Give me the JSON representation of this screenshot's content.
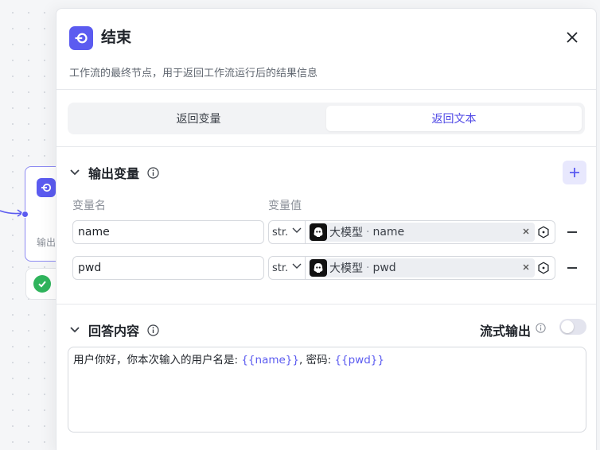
{
  "canvas": {
    "node_label": "输出"
  },
  "panel": {
    "title": "结束",
    "description": "工作流的最终节点，用于返回工作流运行后的结果信息",
    "tabs": [
      {
        "label": "返回变量",
        "active": false
      },
      {
        "label": "返回文本",
        "active": true
      }
    ]
  },
  "output_vars": {
    "title": "输出变量",
    "col_name": "变量名",
    "col_value": "变量值",
    "rows": [
      {
        "name": "name",
        "type": "str.",
        "source": "大模型",
        "field": "name"
      },
      {
        "name": "pwd",
        "type": "str.",
        "source": "大模型",
        "field": "pwd"
      }
    ]
  },
  "answer": {
    "title": "回答内容",
    "stream_label": "流式输出",
    "stream_enabled": false,
    "text_prefix": "用户你好，你本次输入的用户名是: ",
    "var1": "{{name}}",
    "text_mid": ", 密码: ",
    "var2": "{{pwd}}"
  },
  "colors": {
    "accent": "#5b5bf0",
    "success": "#2fb45c"
  },
  "icons": {
    "node_icon": "end-node-icon",
    "close": "close-icon",
    "info": "info-icon",
    "add": "plus-icon",
    "remove": "minus-icon",
    "picker": "variable-picker-icon",
    "clear": "clear-icon",
    "model": "llm-model-icon",
    "check": "check-icon"
  }
}
